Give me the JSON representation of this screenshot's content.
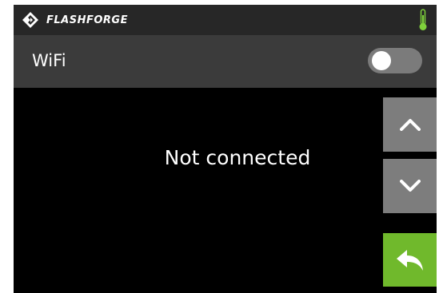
{
  "header": {
    "brand": "FLASHFORGE",
    "logo_icon": "flashforge-diamond-icon",
    "status_icon": "thermometer-icon",
    "status_color": "#7fd13b"
  },
  "wifi": {
    "label": "WiFi",
    "enabled": false
  },
  "main": {
    "status": "Not connected"
  },
  "controls": {
    "up_icon": "chevron-up-icon",
    "down_icon": "chevron-down-icon",
    "back_icon": "back-arrow-icon"
  },
  "colors": {
    "background": "#000000",
    "topbar": "#272727",
    "wifi_row": "#3b3b3b",
    "nav_button": "#7d7d7d",
    "back_button": "#70b92c",
    "toggle_off": "#7b7b7b"
  }
}
